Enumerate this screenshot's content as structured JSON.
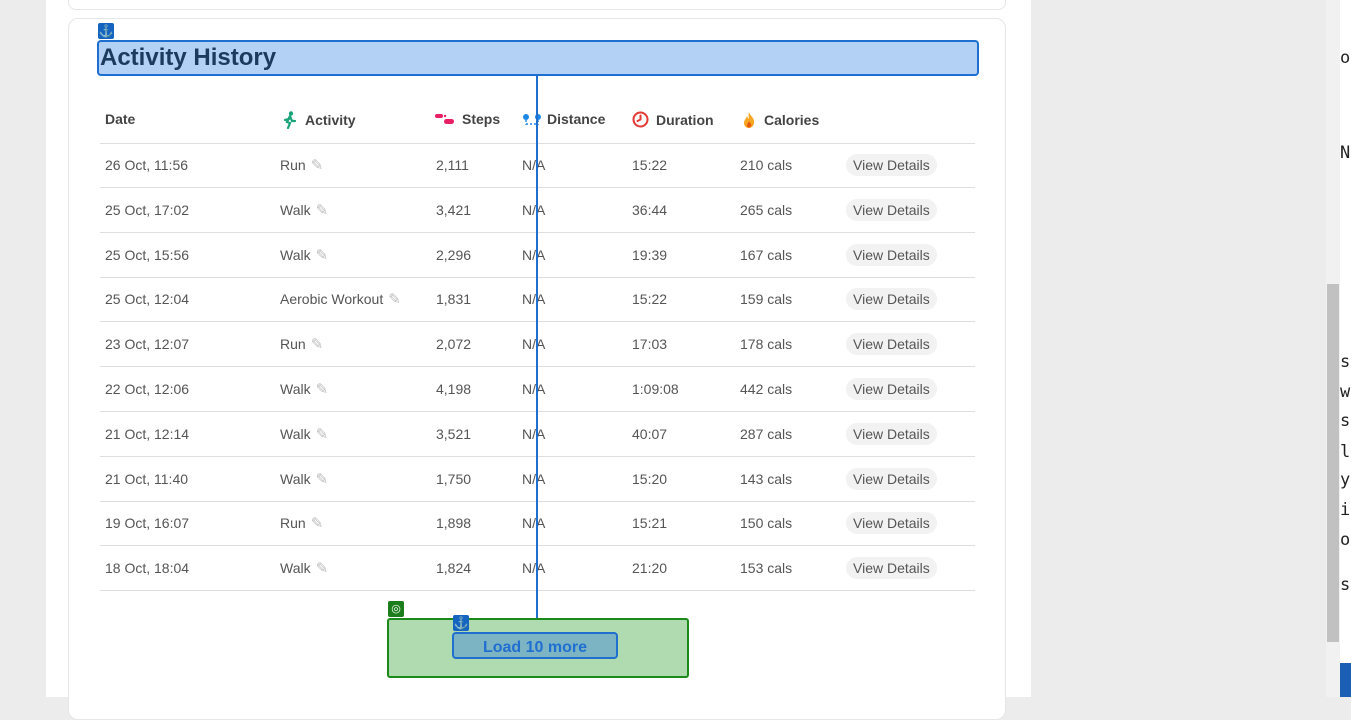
{
  "section_title": "Activity History",
  "columns": {
    "date": "Date",
    "activity": "Activity",
    "steps": "Steps",
    "distance": "Distance",
    "duration": "Duration",
    "calories": "Calories"
  },
  "rows": [
    {
      "date": "26 Oct, 11:56",
      "activity": "Run",
      "steps": "2,111",
      "distance": "N/A",
      "duration": "15:22",
      "calories": "210 cals",
      "action": "View Details"
    },
    {
      "date": "25 Oct, 17:02",
      "activity": "Walk",
      "steps": "3,421",
      "distance": "N/A",
      "duration": "36:44",
      "calories": "265 cals",
      "action": "View Details"
    },
    {
      "date": "25 Oct, 15:56",
      "activity": "Walk",
      "steps": "2,296",
      "distance": "N/A",
      "duration": "19:39",
      "calories": "167 cals",
      "action": "View Details"
    },
    {
      "date": "25 Oct, 12:04",
      "activity": "Aerobic Workout",
      "steps": "1,831",
      "distance": "N/A",
      "duration": "15:22",
      "calories": "159 cals",
      "action": "View Details"
    },
    {
      "date": "23 Oct, 12:07",
      "activity": "Run",
      "steps": "2,072",
      "distance": "N/A",
      "duration": "17:03",
      "calories": "178 cals",
      "action": "View Details"
    },
    {
      "date": "22 Oct, 12:06",
      "activity": "Walk",
      "steps": "4,198",
      "distance": "N/A",
      "duration": "1:09:08",
      "calories": "442 cals",
      "action": "View Details"
    },
    {
      "date": "21 Oct, 12:14",
      "activity": "Walk",
      "steps": "3,521",
      "distance": "N/A",
      "duration": "40:07",
      "calories": "287 cals",
      "action": "View Details"
    },
    {
      "date": "21 Oct, 11:40",
      "activity": "Walk",
      "steps": "1,750",
      "distance": "N/A",
      "duration": "15:20",
      "calories": "143 cals",
      "action": "View Details"
    },
    {
      "date": "19 Oct, 16:07",
      "activity": "Run",
      "steps": "1,898",
      "distance": "N/A",
      "duration": "15:21",
      "calories": "150 cals",
      "action": "View Details"
    },
    {
      "date": "18 Oct, 18:04",
      "activity": "Walk",
      "steps": "1,824",
      "distance": "N/A",
      "duration": "21:20",
      "calories": "153 cals",
      "action": "View Details"
    }
  ],
  "load_more_label": "Load 10 more",
  "icons": {
    "activity": "person-walking-icon",
    "steps": "footprints-icon",
    "distance": "route-pins-icon",
    "duration": "stopwatch-icon",
    "calories": "flame-icon",
    "edit": "pencil-icon",
    "anchor": "anchor-icon",
    "target": "target-icon"
  },
  "side_panel_glyphs": [
    "o",
    "N",
    "s",
    "w",
    "s",
    "l",
    "y",
    "i",
    "o",
    "s"
  ],
  "colors": {
    "highlight_fill": "#b3d1f5",
    "highlight_border": "#1f6fd1",
    "target_fill": "#b0dbb0",
    "target_border": "#1b8a1b",
    "duration_icon": "#e53935",
    "steps_icon": "#e91e63",
    "distance_icon": "#1e88e5"
  }
}
